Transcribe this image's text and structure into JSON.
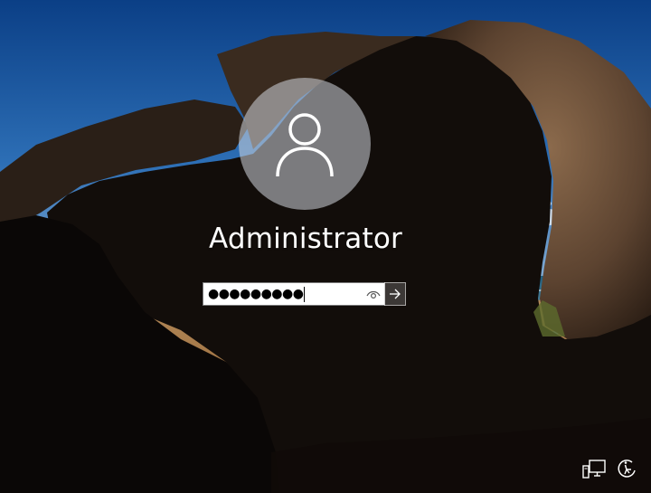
{
  "screen": "Windows Server sign-in",
  "user": {
    "name": "Administrator",
    "avatar_icon": "user-silhouette-icon"
  },
  "password": {
    "masked_value": "●●●●●●●●●",
    "reveal_icon": "eye-icon",
    "submit_icon": "arrow-right-icon"
  },
  "corner_icons": {
    "network": "network-icon",
    "accessibility": "ease-of-access-icon"
  },
  "colors": {
    "accent_text": "#ffffff",
    "avatar_circle": "#c9cfd6",
    "field_bg": "#ffffff"
  }
}
